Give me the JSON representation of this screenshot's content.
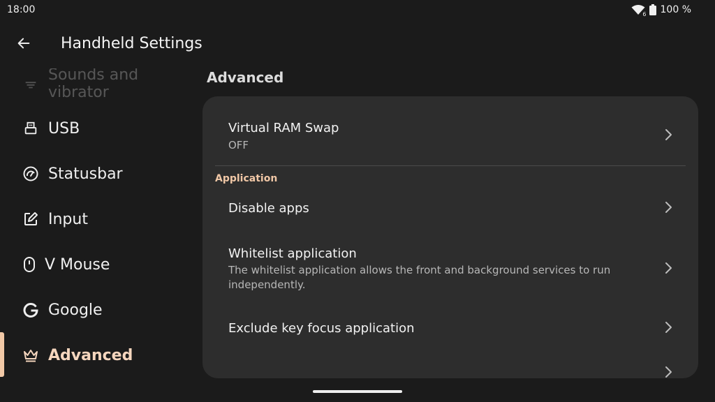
{
  "status": {
    "time": "18:00",
    "battery": "100 %",
    "wifi_badge": "6"
  },
  "header": {
    "title": "Handheld Settings",
    "back_icon": "arrow-left-icon"
  },
  "sidebar": {
    "items": [
      {
        "label": "Sounds and vibrator",
        "icon": "sound-icon"
      },
      {
        "label": "USB",
        "icon": "usb-icon"
      },
      {
        "label": "Statusbar",
        "icon": "gauge-icon"
      },
      {
        "label": "Input",
        "icon": "edit-icon"
      },
      {
        "label": "V Mouse",
        "icon": "mouse-icon"
      },
      {
        "label": "Google",
        "icon": "google-icon"
      },
      {
        "label": "Advanced",
        "icon": "crown-icon",
        "active": true
      }
    ]
  },
  "main": {
    "section_title": "Advanced",
    "rows": [
      {
        "title": "Virtual RAM Swap",
        "subtitle": "OFF"
      },
      {
        "group_header": "Application"
      },
      {
        "title": "Disable apps"
      },
      {
        "title": "Whitelist application",
        "subtitle": "The whitelist application allows the front and background services to run independently."
      },
      {
        "title": "Exclude key focus application"
      }
    ]
  },
  "colors": {
    "background": "#1b1b1b",
    "panel": "#2d2d2d",
    "accent": "#f2c9a7"
  }
}
